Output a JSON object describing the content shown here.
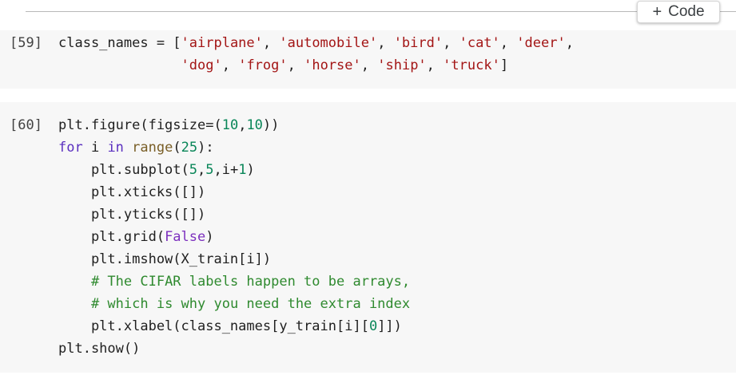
{
  "toolbar": {
    "add_code_icon": "+",
    "add_code_label": "Code"
  },
  "colors": {
    "cell_background": "#f7f7f7",
    "string": "#a31515",
    "keyword": "#7c2fbe",
    "number": "#098658",
    "comment": "#2f8a2f",
    "builtin": "#795e26"
  },
  "cells": [
    {
      "execution_count": "[59]",
      "lines": [
        [
          {
            "t": "plain",
            "v": "class_names = ["
          },
          {
            "t": "str",
            "v": "'airplane'"
          },
          {
            "t": "plain",
            "v": ", "
          },
          {
            "t": "str",
            "v": "'automobile'"
          },
          {
            "t": "plain",
            "v": ", "
          },
          {
            "t": "str",
            "v": "'bird'"
          },
          {
            "t": "plain",
            "v": ", "
          },
          {
            "t": "str",
            "v": "'cat'"
          },
          {
            "t": "plain",
            "v": ", "
          },
          {
            "t": "str",
            "v": "'deer'"
          },
          {
            "t": "plain",
            "v": ","
          }
        ],
        [
          {
            "t": "plain",
            "v": "               "
          },
          {
            "t": "str",
            "v": "'dog'"
          },
          {
            "t": "plain",
            "v": ", "
          },
          {
            "t": "str",
            "v": "'frog'"
          },
          {
            "t": "plain",
            "v": ", "
          },
          {
            "t": "str",
            "v": "'horse'"
          },
          {
            "t": "plain",
            "v": ", "
          },
          {
            "t": "str",
            "v": "'ship'"
          },
          {
            "t": "plain",
            "v": ", "
          },
          {
            "t": "str",
            "v": "'truck'"
          },
          {
            "t": "plain",
            "v": "]"
          }
        ]
      ]
    },
    {
      "execution_count": "[60]",
      "lines": [
        [
          {
            "t": "plain",
            "v": "plt.figure(figsize=("
          },
          {
            "t": "num",
            "v": "10"
          },
          {
            "t": "plain",
            "v": ","
          },
          {
            "t": "num",
            "v": "10"
          },
          {
            "t": "plain",
            "v": "))"
          }
        ],
        [
          {
            "t": "kwfor",
            "v": "for"
          },
          {
            "t": "plain",
            "v": " i "
          },
          {
            "t": "kwfor",
            "v": "in"
          },
          {
            "t": "plain",
            "v": " "
          },
          {
            "t": "builtin",
            "v": "range"
          },
          {
            "t": "plain",
            "v": "("
          },
          {
            "t": "num",
            "v": "25"
          },
          {
            "t": "plain",
            "v": "):"
          }
        ],
        [
          {
            "t": "plain",
            "v": "    plt.subplot("
          },
          {
            "t": "num",
            "v": "5"
          },
          {
            "t": "plain",
            "v": ","
          },
          {
            "t": "num",
            "v": "5"
          },
          {
            "t": "plain",
            "v": ",i+"
          },
          {
            "t": "num",
            "v": "1"
          },
          {
            "t": "plain",
            "v": ")"
          }
        ],
        [
          {
            "t": "plain",
            "v": "    plt.xticks([])"
          }
        ],
        [
          {
            "t": "plain",
            "v": "    plt.yticks([])"
          }
        ],
        [
          {
            "t": "plain",
            "v": "    plt.grid("
          },
          {
            "t": "kw",
            "v": "False"
          },
          {
            "t": "plain",
            "v": ")"
          }
        ],
        [
          {
            "t": "plain",
            "v": "    plt.imshow(X_train[i])"
          }
        ],
        [
          {
            "t": "plain",
            "v": "    "
          },
          {
            "t": "comment",
            "v": "# The CIFAR labels happen to be arrays,"
          }
        ],
        [
          {
            "t": "plain",
            "v": "    "
          },
          {
            "t": "comment",
            "v": "# which is why you need the extra index"
          }
        ],
        [
          {
            "t": "plain",
            "v": "    plt.xlabel(class_names[y_train[i]["
          },
          {
            "t": "num",
            "v": "0"
          },
          {
            "t": "plain",
            "v": "]])"
          }
        ],
        [
          {
            "t": "plain",
            "v": "plt.show()"
          }
        ]
      ]
    }
  ]
}
